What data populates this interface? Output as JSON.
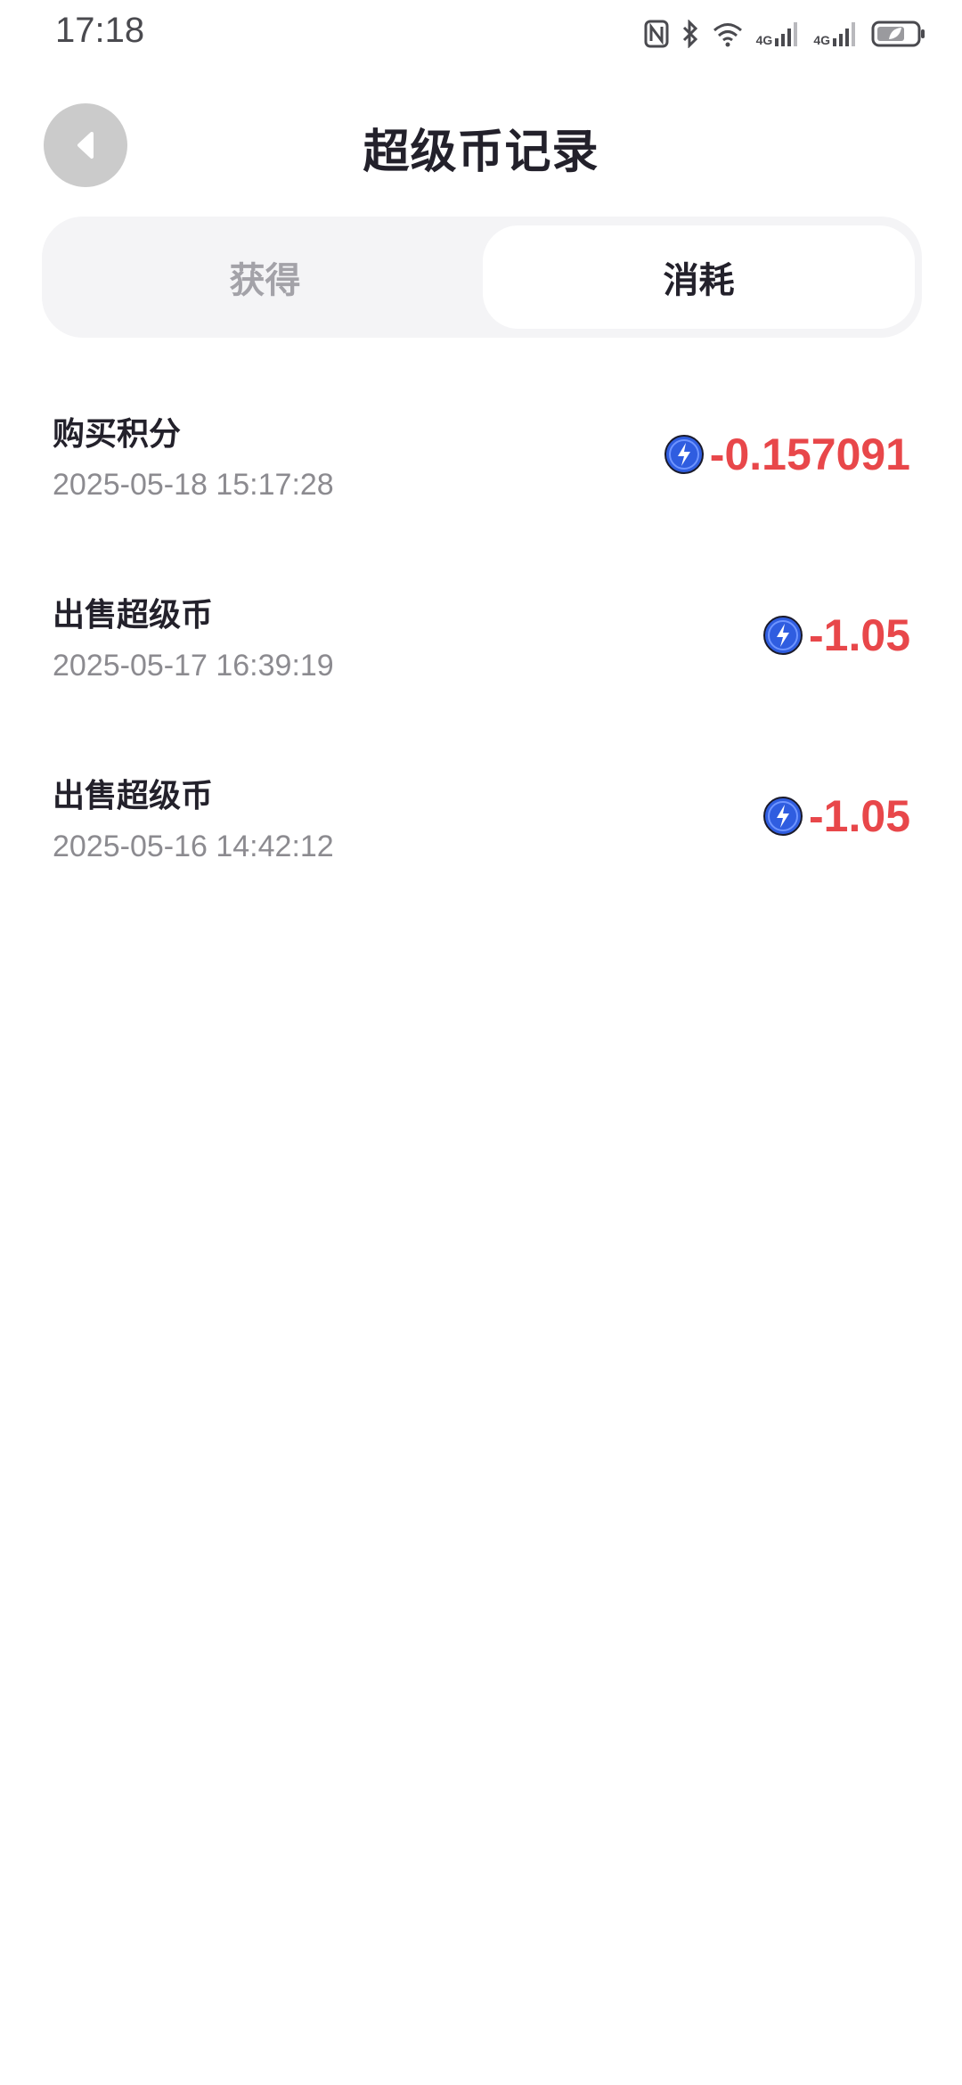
{
  "status_bar": {
    "time": "17:18",
    "network_1": "4G",
    "network_2": "4G",
    "icons": [
      "nfc-icon",
      "bluetooth-icon",
      "wifi-icon",
      "signal-icon",
      "signal-icon",
      "battery-icon"
    ]
  },
  "header": {
    "title": "超级币记录",
    "back_icon": "chevron-left-icon"
  },
  "tabs": [
    {
      "label": "获得",
      "active": false
    },
    {
      "label": "消耗",
      "active": true
    }
  ],
  "records": [
    {
      "title": "购买积分",
      "time": "2025-05-18 15:17:28",
      "amount": "-0.157091"
    },
    {
      "title": "出售超级币",
      "time": "2025-05-17 16:39:19",
      "amount": "-1.05"
    },
    {
      "title": "出售超级币",
      "time": "2025-05-16 14:42:12",
      "amount": "-1.05"
    }
  ],
  "colors": {
    "amount_negative": "#e8474a",
    "title_text": "#23212b",
    "muted_text": "#8c8b90",
    "tab_background": "#f4f4f6",
    "coin_blue": "#2f5de0"
  }
}
